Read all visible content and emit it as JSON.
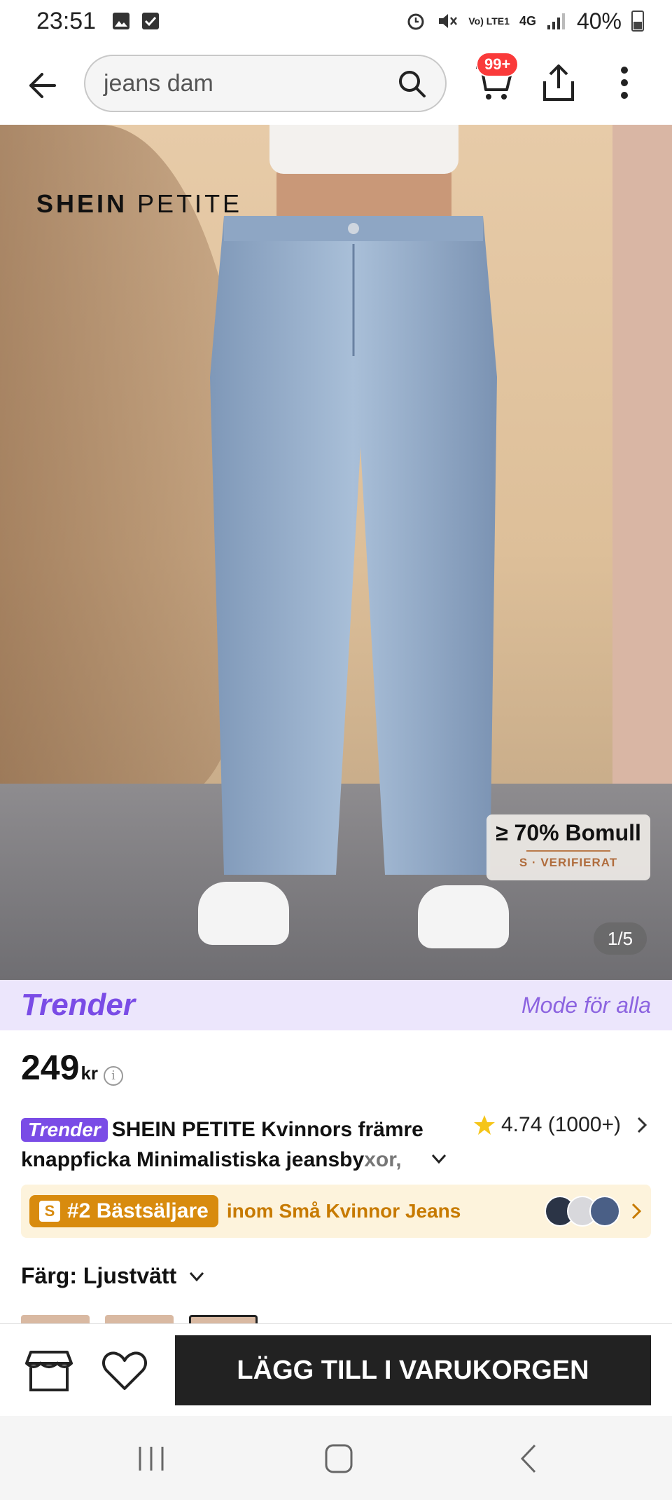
{
  "status_bar": {
    "time": "23:51",
    "network": "Vo) LTE1",
    "net_type": "4G",
    "battery": "40%"
  },
  "header": {
    "search_value": "jeans dam",
    "cart_badge": "99+"
  },
  "image": {
    "brand_text_bold": "SHEIN",
    "brand_text_rest": "PETITE",
    "cotton_main": "≥ 70% Bomull",
    "cotton_sub": "S · VERIFIERAT",
    "page_indicator": "1/5",
    "page_index": 1,
    "page_count": 5
  },
  "trender": {
    "logo": "Trender",
    "tagline": "Mode för alla"
  },
  "product": {
    "price": "249",
    "currency": "kr",
    "trender_tag": "Trender",
    "title_main": "SHEIN PETITE Kvinnors främre knappficka Minimalistiska jeansby",
    "title_fade": "xor,",
    "rating": "4.74",
    "rating_count": "(1000+)"
  },
  "bestseller": {
    "badge": "#2 Bästsäljare",
    "text": "inom Små Kvinnor Jeans"
  },
  "color": {
    "label": "Färg: Ljustvätt"
  },
  "bottom": {
    "add_to_cart": "LÄGG TILL I VARUKORGEN"
  },
  "colors": {
    "accent": "#7a4ce6",
    "badge_red": "#fa3a3a",
    "bestseller_orange": "#d88b0e",
    "button_dark": "#222222",
    "star": "#f5c518"
  }
}
